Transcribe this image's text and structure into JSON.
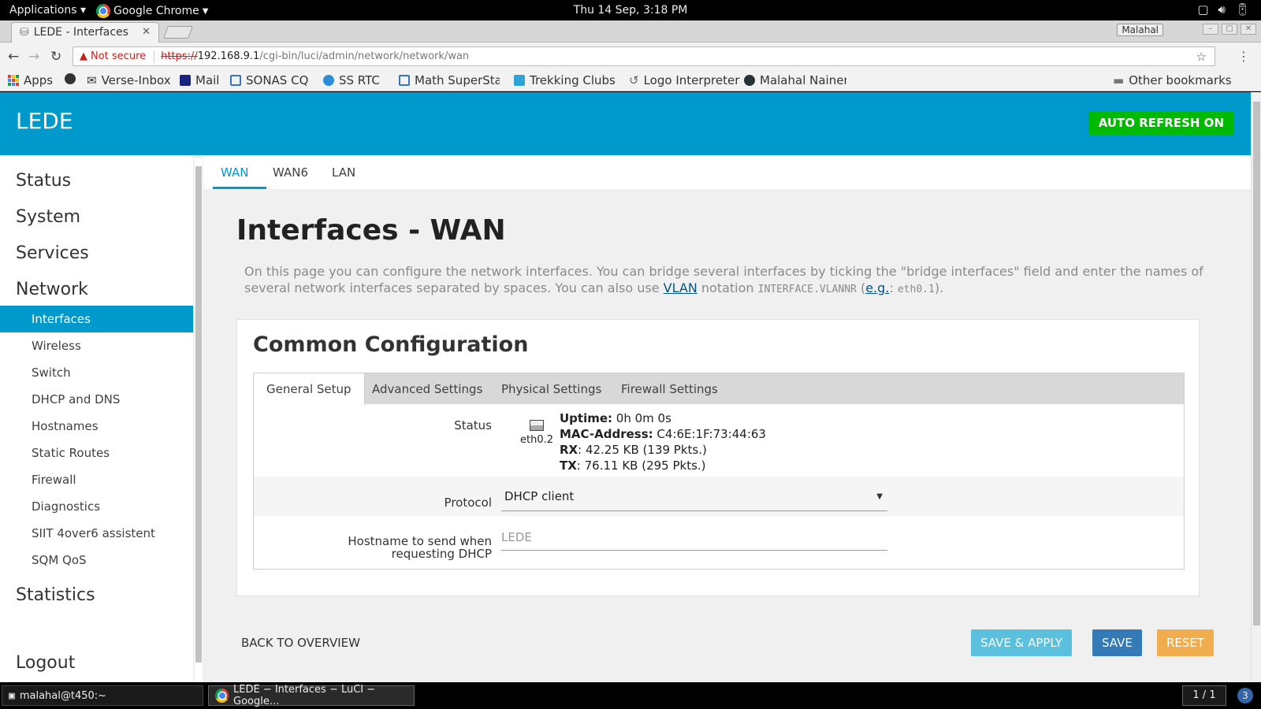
{
  "system_bar": {
    "applications": "Applications ▾",
    "active_app": "Google Chrome",
    "clock": "Thu 14 Sep,  3:18 PM"
  },
  "browser": {
    "tab_title": "LEDE - Interfaces",
    "profile": "Malahal",
    "security": "Not secure",
    "url_scheme": "https://",
    "url_host": "192.168.9.1",
    "url_path": "/cgi-bin/luci/admin/network/network/wan",
    "bookmarks": [
      "Apps",
      "Verse-Inbox",
      "Mail",
      "SONAS CQ",
      "SS RTC",
      "Math SuperStar",
      "Trekking Clubs",
      "Logo Interpreter",
      "Malahal Nainen"
    ],
    "other_bookmarks": "Other bookmarks"
  },
  "header": {
    "brand": "LEDE",
    "auto_refresh": "AUTO REFRESH ON",
    "brand_color": "#0099cc",
    "refresh_color": "#00b900"
  },
  "sidebar": {
    "status": "Status",
    "system": "System",
    "services": "Services",
    "network": "Network",
    "network_items": [
      "Interfaces",
      "Wireless",
      "Switch",
      "DHCP and DNS",
      "Hostnames",
      "Static Routes",
      "Firewall",
      "Diagnostics",
      "SIIT 4over6 assistent",
      "SQM QoS"
    ],
    "statistics": "Statistics",
    "logout": "Logout"
  },
  "iface_tabs": [
    "WAN",
    "WAN6",
    "LAN"
  ],
  "page": {
    "title": "Interfaces - WAN",
    "desc_before_link": "On this page you can configure the network interfaces. You can bridge several interfaces by ticking the \"bridge interfaces\" field and enter the names of several network interfaces separated by spaces. You can also use ",
    "desc_link": "VLAN",
    "desc_after_link": " notation ",
    "desc_code1": "INTERFACE.VLANNR",
    "desc_paren_open": " (",
    "desc_eg": "e.g.",
    "desc_colon": ": ",
    "desc_code2": "eth0.1",
    "desc_end": ")."
  },
  "config": {
    "section_title": "Common Configuration",
    "tabs": [
      "General Setup",
      "Advanced Settings",
      "Physical Settings",
      "Firewall Settings"
    ],
    "status_label": "Status",
    "iface_name": "eth0.2",
    "uptime_label": "Uptime:",
    "uptime_value": " 0h 0m 0s",
    "mac_label": "MAC-Address:",
    "mac_value": " C4:6E:1F:73:44:63",
    "rx_label": "RX",
    "rx_value": ": 42.25 KB (139 Pkts.)",
    "tx_label": "TX",
    "tx_value": ": 76.11 KB (295 Pkts.)",
    "protocol_label": "Protocol",
    "protocol_value": "DHCP client",
    "hostname_label": "Hostname to send when requesting DHCP",
    "hostname_placeholder": "LEDE"
  },
  "actions": {
    "back": "BACK TO OVERVIEW",
    "save_apply": "SAVE & APPLY",
    "save": "SAVE",
    "reset": "RESET"
  },
  "taskbar": {
    "terminal": "malahal@t450:~",
    "browser": "LEDE − Interfaces − LuCI − Google...",
    "workspace": "1 / 1",
    "notifications": "3"
  }
}
